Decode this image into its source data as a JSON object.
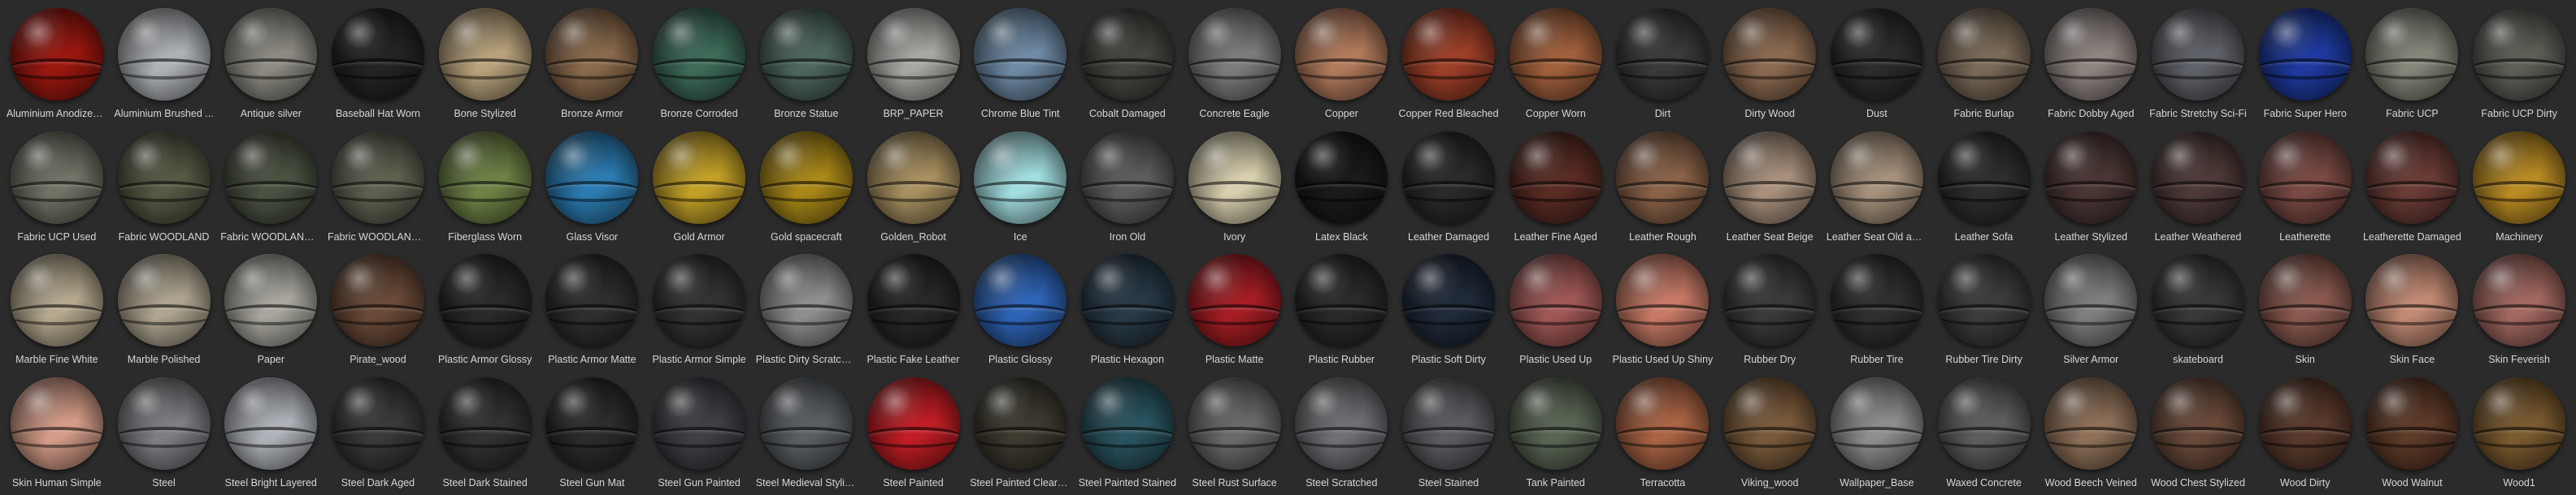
{
  "materials": [
    {
      "name": "Aluminium Anodized ...",
      "color": "#9a1810"
    },
    {
      "name": "Aluminium Brushed ...",
      "color": "#aeb2b6"
    },
    {
      "name": "Antique silver",
      "color": "#8c8a82"
    },
    {
      "name": "Baseball Hat Worn",
      "color": "#242426"
    },
    {
      "name": "Bone Stylized",
      "color": "#b8a27c"
    },
    {
      "name": "Bronze Armor",
      "color": "#8a6a4c"
    },
    {
      "name": "Bronze Corroded",
      "color": "#3d6b58"
    },
    {
      "name": "Bronze Statue",
      "color": "#4e6660"
    },
    {
      "name": "BRP_PAPER",
      "color": "#a9a7a2"
    },
    {
      "name": "Chrome Blue Tint",
      "color": "#6e8aa6"
    },
    {
      "name": "Cobalt Damaged",
      "color": "#45443f"
    },
    {
      "name": "Concrete Eagle",
      "color": "#7c7c7a"
    },
    {
      "name": "Copper",
      "color": "#b27a5c"
    },
    {
      "name": "Copper Red Bleached",
      "color": "#9c3f28"
    },
    {
      "name": "Copper Worn",
      "color": "#a0603c"
    },
    {
      "name": "Dirt",
      "color": "#3c3a38"
    },
    {
      "name": "Dirty Wood",
      "color": "#8c6a50"
    },
    {
      "name": "Dust",
      "color": "#2c2c2e"
    },
    {
      "name": "Fabric Burlap",
      "color": "#7a6a58"
    },
    {
      "name": "Fabric Dobby Aged",
      "color": "#8e8480"
    },
    {
      "name": "Fabric Stretchy Sci-Fi",
      "color": "#5f6268"
    },
    {
      "name": "Fabric Super Hero",
      "color": "#1e3a9e"
    },
    {
      "name": "Fabric UCP",
      "color": "#85857a"
    },
    {
      "name": "Fabric UCP Dirty",
      "color": "#5d5e56"
    },
    {
      "name": "Fabric UCP Used",
      "color": "#727266"
    },
    {
      "name": "Fabric WOODLAND",
      "color": "#545a44"
    },
    {
      "name": "Fabric WOODLAND D...",
      "color": "#4b5242"
    },
    {
      "name": "Fabric WOODLAND U...",
      "color": "#5d6250"
    },
    {
      "name": "Fiberglass Worn",
      "color": "#6e8246"
    },
    {
      "name": "Glass Visor",
      "color": "#2c7cb2"
    },
    {
      "name": "Gold Armor",
      "color": "#c2a028"
    },
    {
      "name": "Gold spacecraft",
      "color": "#a88818"
    },
    {
      "name": "Golden_Robot",
      "color": "#a89060"
    },
    {
      "name": "Ice",
      "color": "#a2dde0"
    },
    {
      "name": "Iron Old",
      "color": "#5d5d5e"
    },
    {
      "name": "Ivory",
      "color": "#d8cfae"
    },
    {
      "name": "Latex Black",
      "color": "#1a1a1c"
    },
    {
      "name": "Leather Damaged",
      "color": "#2a2a2a"
    },
    {
      "name": "Leather Fine Aged",
      "color": "#5a2c24"
    },
    {
      "name": "Leather Rough",
      "color": "#8a6248"
    },
    {
      "name": "Leather Seat Beige",
      "color": "#a8907c"
    },
    {
      "name": "Leather Seat Old and ...",
      "color": "#a6917c"
    },
    {
      "name": "Leather Sofa",
      "color": "#2e2e2e"
    },
    {
      "name": "Leather Stylized",
      "color": "#4a3634"
    },
    {
      "name": "Leather Weathered",
      "color": "#4e3a38"
    },
    {
      "name": "Leatherette",
      "color": "#7a4a44"
    },
    {
      "name": "Leatherette Damaged",
      "color": "#6a3c36"
    },
    {
      "name": "Machinery",
      "color": "#b88a24"
    },
    {
      "name": "Marble Fine White",
      "color": "#b4a88e"
    },
    {
      "name": "Marble Polished",
      "color": "#aea490"
    },
    {
      "name": "Paper",
      "color": "#a8a69e"
    },
    {
      "name": "Pirate_wood",
      "color": "#6a4a38"
    },
    {
      "name": "Plastic Armor Glossy",
      "color": "#2a2a2c"
    },
    {
      "name": "Plastic Armor Matte",
      "color": "#2e2e30"
    },
    {
      "name": "Plastic Armor Simple",
      "color": "#333335"
    },
    {
      "name": "Plastic Dirty Scratched",
      "color": "#8e8e8e"
    },
    {
      "name": "Plastic Fake Leather",
      "color": "#28282a"
    },
    {
      "name": "Plastic Glossy",
      "color": "#2f64b6"
    },
    {
      "name": "Plastic Hexagon",
      "color": "#283a48"
    },
    {
      "name": "Plastic Matte",
      "color": "#a41e24"
    },
    {
      "name": "Plastic Rubber",
      "color": "#2a2a2c"
    },
    {
      "name": "Plastic Soft Dirty",
      "color": "#202a3a"
    },
    {
      "name": "Plastic Used Up",
      "color": "#a05856"
    },
    {
      "name": "Plastic Used Up Shiny",
      "color": "#c87a66"
    },
    {
      "name": "Rubber Dry",
      "color": "#3a3a3a"
    },
    {
      "name": "Rubber Tire",
      "color": "#303030"
    },
    {
      "name": "Rubber Tire Dirty",
      "color": "#3c3c3c"
    },
    {
      "name": "Silver Armor",
      "color": "#7e7e80"
    },
    {
      "name": "skateboard",
      "color": "#38383a"
    },
    {
      "name": "Skin",
      "color": "#8a5a50"
    },
    {
      "name": "Skin Face",
      "color": "#c28a74"
    },
    {
      "name": "Skin Feverish",
      "color": "#a26860"
    },
    {
      "name": "Skin Human Simple",
      "color": "#d49c88"
    },
    {
      "name": "Steel",
      "color": "#7c7e82"
    },
    {
      "name": "Steel Bright Layered",
      "color": "#aeb2b8"
    },
    {
      "name": "Steel Dark Aged",
      "color": "#3a3a3a"
    },
    {
      "name": "Steel Dark Stained",
      "color": "#323234"
    },
    {
      "name": "Steel Gun Mat",
      "color": "#2c2c2e"
    },
    {
      "name": "Steel Gun Painted",
      "color": "#3e4046"
    },
    {
      "name": "Steel Medieval Stylized",
      "color": "#5a5f64"
    },
    {
      "name": "Steel Painted",
      "color": "#c01e24"
    },
    {
      "name": "Steel Painted Clearcoat",
      "color": "#3e3a30"
    },
    {
      "name": "Steel Painted Stained",
      "color": "#2a5460"
    },
    {
      "name": "Steel Rust Surface",
      "color": "#6a6a6a"
    },
    {
      "name": "Steel Scratched",
      "color": "#6e7074"
    },
    {
      "name": "Steel Stained",
      "color": "#5a5c60"
    },
    {
      "name": "Tank Painted",
      "color": "#5a6654"
    },
    {
      "name": "Terracotta",
      "color": "#aa6444"
    },
    {
      "name": "Viking_wood",
      "color": "#7a5a3a"
    },
    {
      "name": "Wallpaper_Base",
      "color": "#8e8e8e"
    },
    {
      "name": "Waxed Concrete",
      "color": "#5e5e5e"
    },
    {
      "name": "Wood Beech Veined",
      "color": "#8e7058"
    },
    {
      "name": "Wood Chest Stylized",
      "color": "#6a4a3a"
    },
    {
      "name": "Wood Dirty",
      "color": "#5a3a2c"
    },
    {
      "name": "Wood Walnut",
      "color": "#5e3a28"
    },
    {
      "name": "Wood1",
      "color": "#7a5a30"
    }
  ]
}
